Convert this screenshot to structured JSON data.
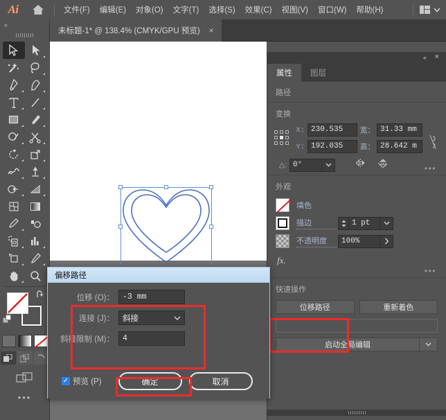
{
  "app": {
    "logo": "Ai",
    "home_icon": "home-icon"
  },
  "menubar": {
    "items": [
      {
        "label": "文件(F)"
      },
      {
        "label": "编辑(E)"
      },
      {
        "label": "对象(O)"
      },
      {
        "label": "文字(T)"
      },
      {
        "label": "选择(S)"
      },
      {
        "label": "效果(C)"
      },
      {
        "label": "视图(V)"
      },
      {
        "label": "窗口(W)"
      },
      {
        "label": "帮助(H)"
      }
    ],
    "workspace_switcher_icon": "workspace-grid-icon",
    "workspace_caret": "chevron-down-icon"
  },
  "document_tab": {
    "label": "未标题-1* @ 138.4% (CMYK/GPU 预览)",
    "close": "×"
  },
  "toolbar": {
    "collapse": "«",
    "tools": [
      {
        "name": "selection-tool",
        "selected": true
      },
      {
        "name": "direct-selection-tool",
        "selected": false
      },
      {
        "name": "magic-wand-tool",
        "selected": false
      },
      {
        "name": "lasso-tool",
        "selected": false
      },
      {
        "name": "pen-tool",
        "selected": false
      },
      {
        "name": "curvature-tool",
        "selected": false
      },
      {
        "name": "type-tool",
        "selected": false
      },
      {
        "name": "line-segment-tool",
        "selected": false
      },
      {
        "name": "rectangle-tool",
        "selected": false
      },
      {
        "name": "paintbrush-tool",
        "selected": false
      },
      {
        "name": "shaper-tool",
        "selected": false
      },
      {
        "name": "scissors-tool",
        "selected": false
      },
      {
        "name": "rotate-tool",
        "selected": false
      },
      {
        "name": "scale-tool",
        "selected": false
      },
      {
        "name": "width-tool",
        "selected": false
      },
      {
        "name": "free-transform-tool",
        "selected": false
      },
      {
        "name": "shape-builder-tool",
        "selected": false
      },
      {
        "name": "perspective-grid-tool",
        "selected": false
      },
      {
        "name": "mesh-tool",
        "selected": false
      },
      {
        "name": "gradient-tool",
        "selected": false
      },
      {
        "name": "eyedropper-tool",
        "selected": false
      },
      {
        "name": "blend-tool",
        "selected": false
      },
      {
        "name": "symbol-sprayer-tool",
        "selected": false
      },
      {
        "name": "column-graph-tool",
        "selected": false
      },
      {
        "name": "artboard-tool",
        "selected": false
      },
      {
        "name": "slice-tool",
        "selected": false
      },
      {
        "name": "hand-tool",
        "selected": false
      },
      {
        "name": "zoom-tool",
        "selected": false
      }
    ],
    "fill_swatch": "none-fill-swatch",
    "stroke_swatch": "stroke-swatch",
    "swap_icon": "swap-fill-stroke-icon",
    "default_icon": "default-fill-stroke-icon",
    "mini_modes": [
      "solid-color-mode",
      "gradient-mode",
      "none-mode"
    ],
    "draw_modes": [
      "draw-normal",
      "draw-behind",
      "draw-inside"
    ],
    "more": "•••"
  },
  "properties_panel": {
    "collapse_icon": "«",
    "close_icon": "×",
    "tabs": [
      {
        "label": "属性",
        "active": true
      },
      {
        "label": "图层",
        "active": false
      }
    ],
    "object_type": "路径",
    "transform": {
      "title": "变换",
      "reference_point": "reference-point-widget",
      "x_label": "X:",
      "x_value": "230.535",
      "y_label": "Y:",
      "y_value": "192.035",
      "w_label": "宽：",
      "w_value": "31.33 mm",
      "h_label": "高：",
      "h_value": "28.642 m",
      "link_icon": "unlink-proportions-icon",
      "angle_label": "△:",
      "angle_value": "0°",
      "flip_horizontal_icon": "flip-horizontal-icon",
      "flip_vertical_icon": "flip-vertical-icon",
      "more": "•••"
    },
    "appearance": {
      "title": "外观",
      "fill_label": "填色",
      "fill_swatch": "none-fill-swatch",
      "stroke_label": "描边",
      "stroke_swatch": "stroke-square-swatch",
      "stroke_weight": "1 pt",
      "opacity_label": "不透明度",
      "opacity_value": "100%",
      "opacity_swatch": "transparency-checker-swatch",
      "fx_label": "fx.",
      "more": "•••"
    },
    "quick_actions": {
      "title": "快速操作",
      "offset_path": "位移路径",
      "recolor": "重新着色",
      "blank_field": "",
      "start_global_edit": "启动全局编辑",
      "caret": "chevron-down-icon"
    }
  },
  "offset_dialog": {
    "title": "偏移路径",
    "offset_label": "位移 (O)：",
    "offset_value": "-3 mm",
    "join_label": "连接 (J)：",
    "join_value": "斜接",
    "join_caret": "chevron-down-icon",
    "miter_label": "斜接限制 (M)：",
    "miter_value": "4",
    "preview_label": "预览 (P)",
    "preview_checked": true,
    "ok_label": "确定",
    "cancel_label": "取消"
  },
  "canvas": {
    "shape": "nested-heart-paths",
    "selection": "selection-bounding-box"
  },
  "colors": {
    "ui_bg": "#535353",
    "panel_dark": "#3c3c3c",
    "input_bg": "#3d3d3d",
    "accent_orange": "#ff9a5b",
    "annotation_red": "#ee2b2b",
    "path_blue": "#5b8fd4",
    "dialog_title": "#c9e0f4",
    "checkbox_blue": "#2a7ff0"
  }
}
